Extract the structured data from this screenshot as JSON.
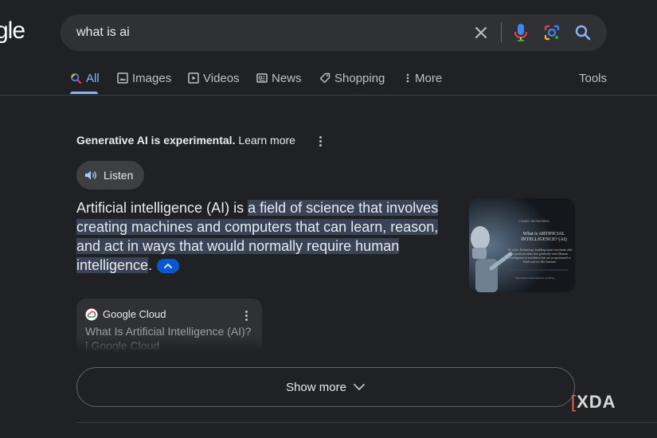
{
  "logo": {
    "text": "gle"
  },
  "search": {
    "query": "what is ai"
  },
  "tabs": [
    {
      "label": "All",
      "icon": "search-icon"
    },
    {
      "label": "Images",
      "icon": "image-icon"
    },
    {
      "label": "Videos",
      "icon": "play-icon"
    },
    {
      "label": "News",
      "icon": "newspaper-icon"
    },
    {
      "label": "Shopping",
      "icon": "tag-icon"
    },
    {
      "label": "More",
      "icon": "more-vertical-icon"
    }
  ],
  "tools_label": "Tools",
  "ai_overview": {
    "notice": "Generative AI is experimental.",
    "learn_more": "Learn more",
    "listen_label": "Listen",
    "answer_prefix": "Artificial intelligence (AI) is ",
    "answer_highlight": "a field of science that involves creating machines and computers that can learn, reason, and act in ways that would normally require human intelligence",
    "answer_suffix": ".",
    "thumbnail": {
      "brand": "CODEC NETWORKS",
      "heading": "What is ARTIFICIAL INTELLIGENCE? (AI)",
      "body": "AI is the Technology building smart machines able to perform tasks that generally need Human Intelligence in machines that are programmed to think and act like humans.",
      "url": "https://www.codecnetworks.com/blog"
    },
    "source": {
      "name": "Google Cloud",
      "title": "What Is Artificial Intelligence (AI)? | Google Cloud"
    },
    "show_more_label": "Show more"
  },
  "watermark": {
    "text": "XDA"
  },
  "colors": {
    "accent": "#8ab4f8",
    "background": "#202124",
    "highlight": "#394457",
    "collapse_button": "#0b57d0"
  }
}
